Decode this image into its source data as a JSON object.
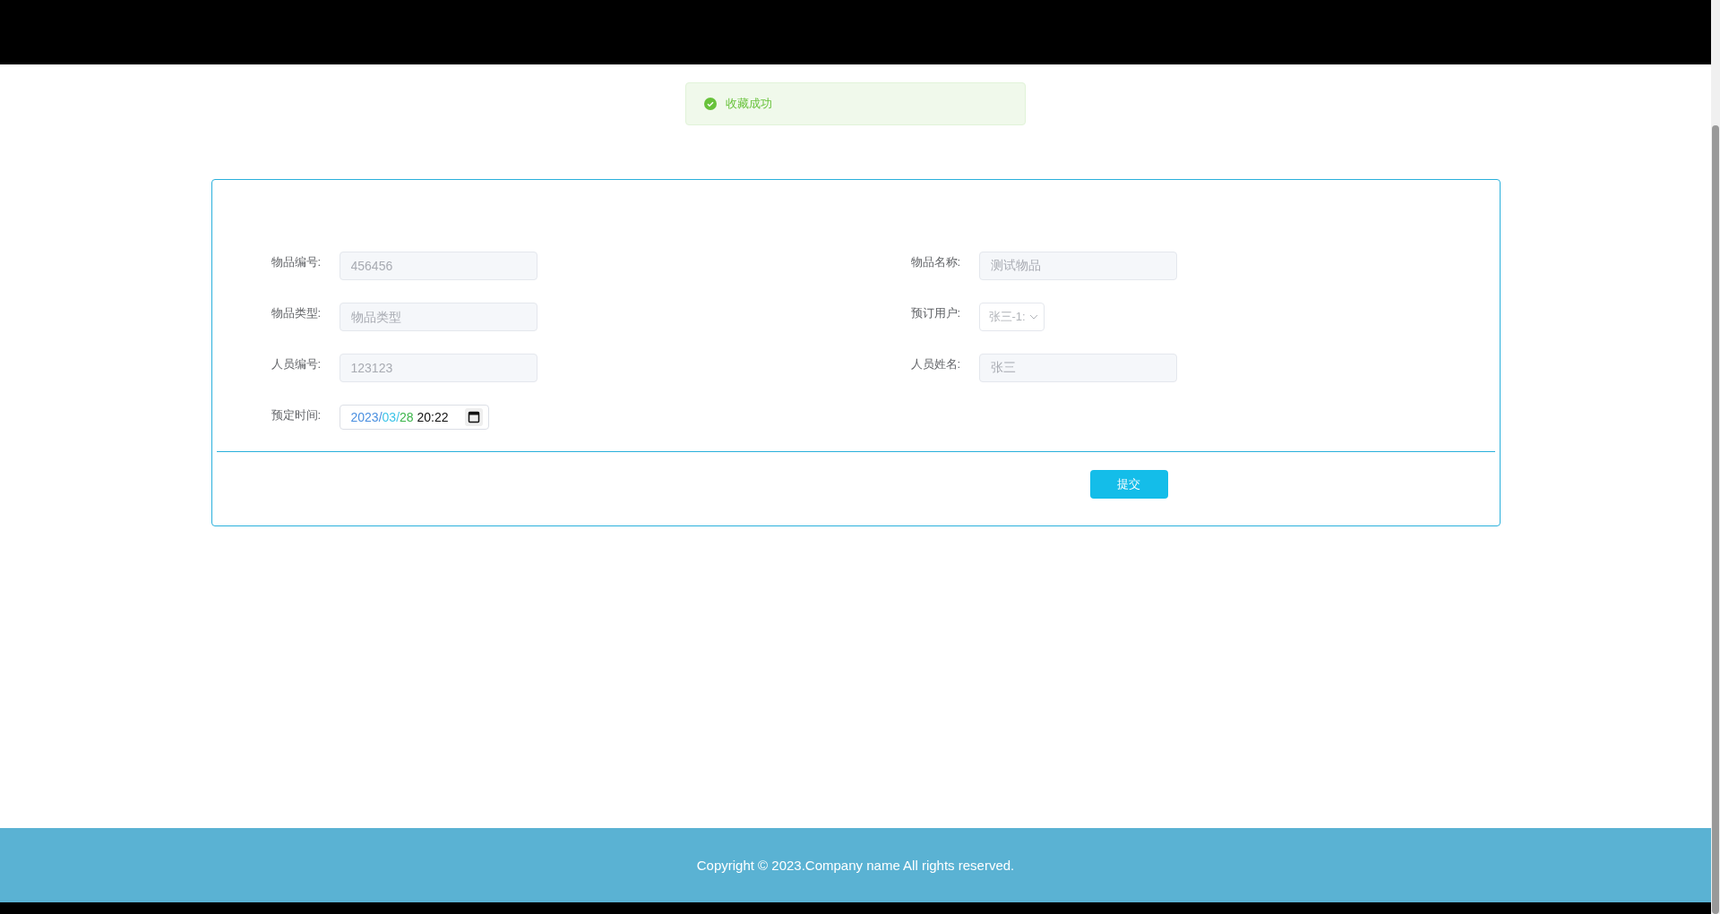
{
  "toast": {
    "kind": "success",
    "message": "收藏成功"
  },
  "form": {
    "fields": [
      {
        "kind": "input",
        "label": "物品编号:",
        "value": "456456",
        "disabled": true
      },
      {
        "kind": "input",
        "label": "物品名称:",
        "value": "测试物品",
        "disabled": true
      },
      {
        "kind": "input",
        "label": "物品类型:",
        "placeholder": "物品类型",
        "disabled": true
      },
      {
        "kind": "select",
        "label": "预订用户:",
        "value": "张三-1:",
        "disabled": true
      },
      {
        "kind": "input",
        "label": "人员编号:",
        "value": "123123",
        "disabled": true
      },
      {
        "kind": "input",
        "label": "人员姓名:",
        "value": "张三",
        "disabled": true
      },
      {
        "kind": "date",
        "label": "预定时间:",
        "segments": [
          {
            "text": "2023",
            "color": "#4a8fe0"
          },
          {
            "text": "/",
            "color": "#4a8fe0"
          },
          {
            "text": "03",
            "color": "#3cc4e8"
          },
          {
            "text": "/",
            "color": "#3cc4e8"
          },
          {
            "text": "28",
            "color": "#3bb54a"
          },
          {
            "text": " 20:22",
            "color": "#111111"
          }
        ]
      }
    ],
    "submit": "提交"
  },
  "footer": {
    "text": "Copyright © 2023.Company name All rights reserved."
  }
}
